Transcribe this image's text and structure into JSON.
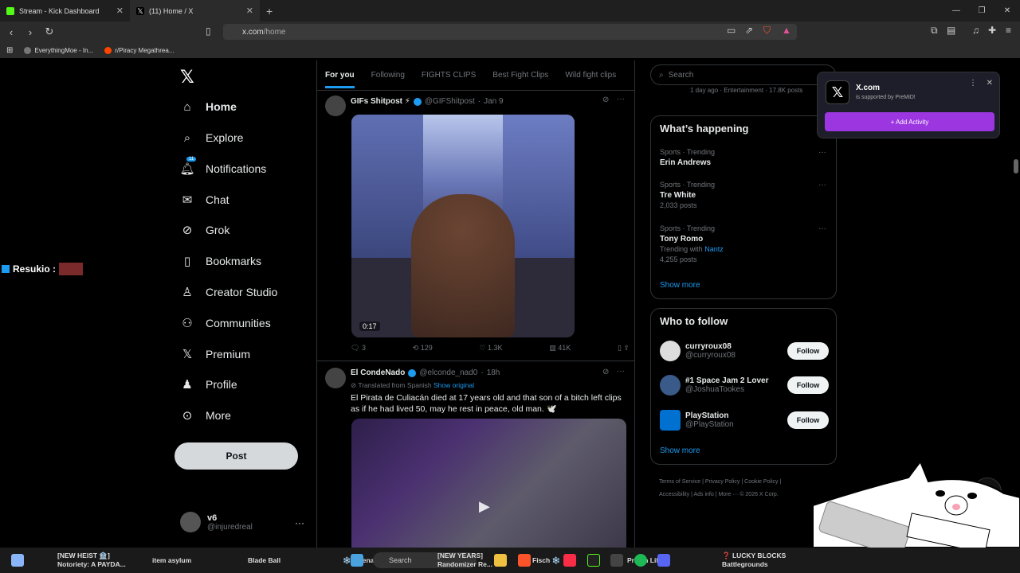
{
  "browser": {
    "tabs": [
      {
        "label": "Stream - Kick Dashboard"
      },
      {
        "label": "(11) Home / X"
      }
    ],
    "url_host": "x.com",
    "url_path": "/home",
    "bookmarks": [
      "EverythingMoe - In...",
      "r/Piracy Megathrea..."
    ]
  },
  "nav": {
    "items": [
      {
        "label": "Home",
        "icon": "home-icon"
      },
      {
        "label": "Explore",
        "icon": "search-icon"
      },
      {
        "label": "Notifications",
        "icon": "bell-icon",
        "badge": "11"
      },
      {
        "label": "Chat",
        "icon": "mail-icon"
      },
      {
        "label": "Grok",
        "icon": "grok-icon"
      },
      {
        "label": "Bookmarks",
        "icon": "bookmark-icon"
      },
      {
        "label": "Creator Studio",
        "icon": "creator-icon"
      },
      {
        "label": "Communities",
        "icon": "people-icon"
      },
      {
        "label": "Premium",
        "icon": "x-icon"
      },
      {
        "label": "Profile",
        "icon": "person-icon"
      },
      {
        "label": "More",
        "icon": "more-circle-icon"
      }
    ],
    "post_label": "Post",
    "account": {
      "name": "v6",
      "handle": "@injuredreal"
    }
  },
  "feed": {
    "tabs": [
      "For you",
      "Following",
      "FIGHTS CLIPS",
      "Best Fight Clips",
      "Wild fight clips"
    ],
    "tweets": [
      {
        "author": "GIFs Shitpost ⚡",
        "handle": "@GIFShitpost",
        "time": "Jan 9",
        "duration": "0:17",
        "replies": "3",
        "reposts": "129",
        "likes": "1.3K",
        "views": "41K"
      },
      {
        "author": "El CondeNado",
        "handle": "@elconde_nad0",
        "time": "18h",
        "translated": "Translated from Spanish",
        "show_original": "Show original",
        "text": "El Pirata de Culiacán died at 17 years old and that son of a bitch left clips as if he had lived 50, may he rest in peace, old man. 🕊️"
      }
    ]
  },
  "sidebar": {
    "search_placeholder": "Search",
    "top_snippet": "1 day ago · Entertainment · 17.8K posts",
    "whats_happening": "What’s happening",
    "trends": [
      {
        "context": "Sports · Trending",
        "name": "Erin Andrews",
        "extra": ""
      },
      {
        "context": "Sports · Trending",
        "name": "Tre White",
        "extra": "2,033 posts"
      },
      {
        "context": "Sports · Trending",
        "name": "Tony Romo",
        "with": "Trending with",
        "with_link": "Nantz",
        "extra": "4,255 posts"
      }
    ],
    "show_more": "Show more",
    "who_to_follow": "Who to follow",
    "follow": [
      {
        "name": "curryroux08",
        "handle": "@curryroux08"
      },
      {
        "name": "#1 Space Jam 2 Lover",
        "handle": "@JoshuaTookes"
      },
      {
        "name": "PlayStation",
        "handle": "@PlayStation"
      }
    ],
    "follow_label": "Follow",
    "footer": [
      "Terms of Service",
      "Privacy Policy",
      "Cookie Policy",
      "Accessibility",
      "Ads info",
      "More ···",
      "© 2026 X Corp."
    ]
  },
  "popup": {
    "title": "X.com",
    "subtitle": "is supported by PreMiD!",
    "button": "+ Add Activity"
  },
  "overlay": {
    "chat_name": "Resukio :"
  },
  "taskbar": {
    "search": "Search",
    "games": [
      {
        "title": "[NEW HEIST 🏦]",
        "sub": "Notoriety: A PAYDA..."
      },
      {
        "title": "item asylum",
        "sub": ""
      },
      {
        "title": "Blade Ball",
        "sub": ""
      },
      {
        "title": "❄️Arsenal",
        "sub": ""
      },
      {
        "title": "[NEW YEARS]",
        "sub": "Randomizer Re..."
      },
      {
        "title": "Fisch ❄️",
        "sub": ""
      },
      {
        "title": "Prison Life",
        "sub": ""
      },
      {
        "title": "❓ LUCKY BLOCKS",
        "sub": "Battlegrounds"
      }
    ]
  }
}
